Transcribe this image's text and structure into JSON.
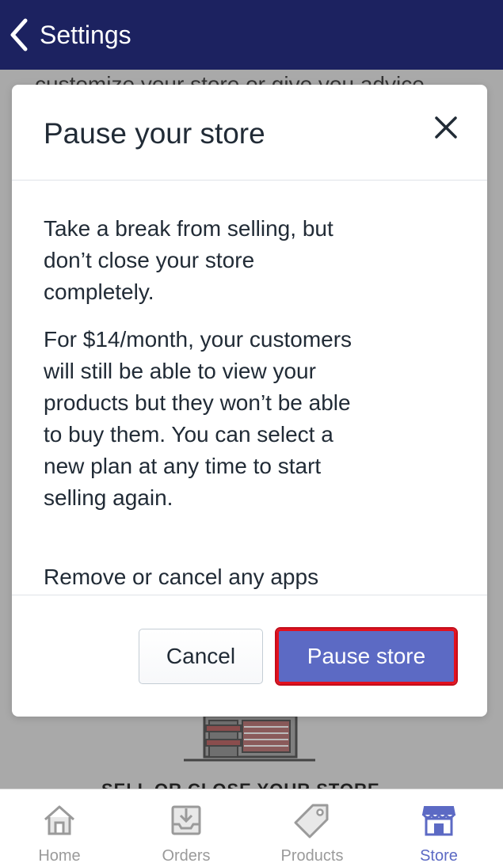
{
  "nav": {
    "title": "Settings"
  },
  "background": {
    "top_text": "customize your store or give you advice",
    "heading": "SELL OR CLOSE YOUR STORE"
  },
  "modal": {
    "title": "Pause your store",
    "paragraphs": [
      "Take a break from selling, but don’t close your store completely.",
      "For $14/month, your customers will still be able to view your products but they won’t be able to buy them. You can select a new plan at any time to start selling again.",
      "Remove or cancel any apps"
    ],
    "cancel_label": "Cancel",
    "confirm_label": "Pause store"
  },
  "tabs": [
    {
      "label": "Home",
      "icon": "home-icon",
      "active": false
    },
    {
      "label": "Orders",
      "icon": "orders-icon",
      "active": false
    },
    {
      "label": "Products",
      "icon": "tag-icon",
      "active": false
    },
    {
      "label": "Store",
      "icon": "store-icon",
      "active": true
    }
  ],
  "colors": {
    "nav_bg": "#1c2260",
    "primary": "#5c6ac4",
    "highlight_border": "#e3101e",
    "tab_inactive": "#9a9a9a"
  }
}
